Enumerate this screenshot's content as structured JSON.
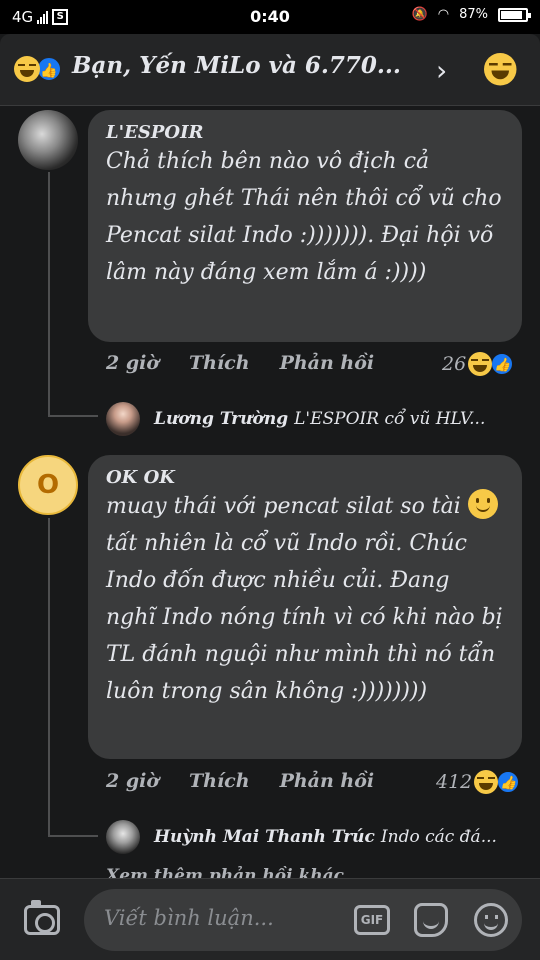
{
  "status_bar": {
    "network": "4G",
    "sim_icon_label": "S",
    "time": "0:40",
    "battery": "87%"
  },
  "header": {
    "title": "Bạn, Yến MiLo và 6.770...",
    "chevron": "›"
  },
  "comments": [
    {
      "author": "L'ESPOIR",
      "text": "Chả thích bên nào vô địch cả nhưng ghét Thái nên thôi cổ vũ cho Pencat silat Indo :))))))). Đại hội võ lâm này đáng xem lắm á :))))",
      "time": "2 giờ",
      "like_label": "Thích",
      "reply_label": "Phản hồi",
      "reaction_count": "26",
      "reply_preview": {
        "name": "Lương Trường",
        "snippet": "L'ESPOIR cổ vũ HLV..."
      }
    },
    {
      "author": "OK OK",
      "avatar_letter": "O",
      "text_before_emoji": "muay thái với pencat silat so tài",
      "text_after_emoji": " tất nhiên là cổ vũ Indo rồi. Chúc Indo đốn được nhiều củi. Đang nghĩ Indo nóng tính vì có khi nào bị TL đánh nguội như mình thì nó tẩn luôn trong sân không :))))))))",
      "time": "2 giờ",
      "like_label": "Thích",
      "reply_label": "Phản hồi",
      "reaction_count": "412",
      "reply_preview": {
        "name": "Huỳnh Mai Thanh Trúc",
        "snippet": "Indo các đá..."
      }
    }
  ],
  "more_replies": "Xem thêm phản hồi khác",
  "composer": {
    "placeholder": "Viết bình luận...",
    "gif_label": "GIF"
  }
}
